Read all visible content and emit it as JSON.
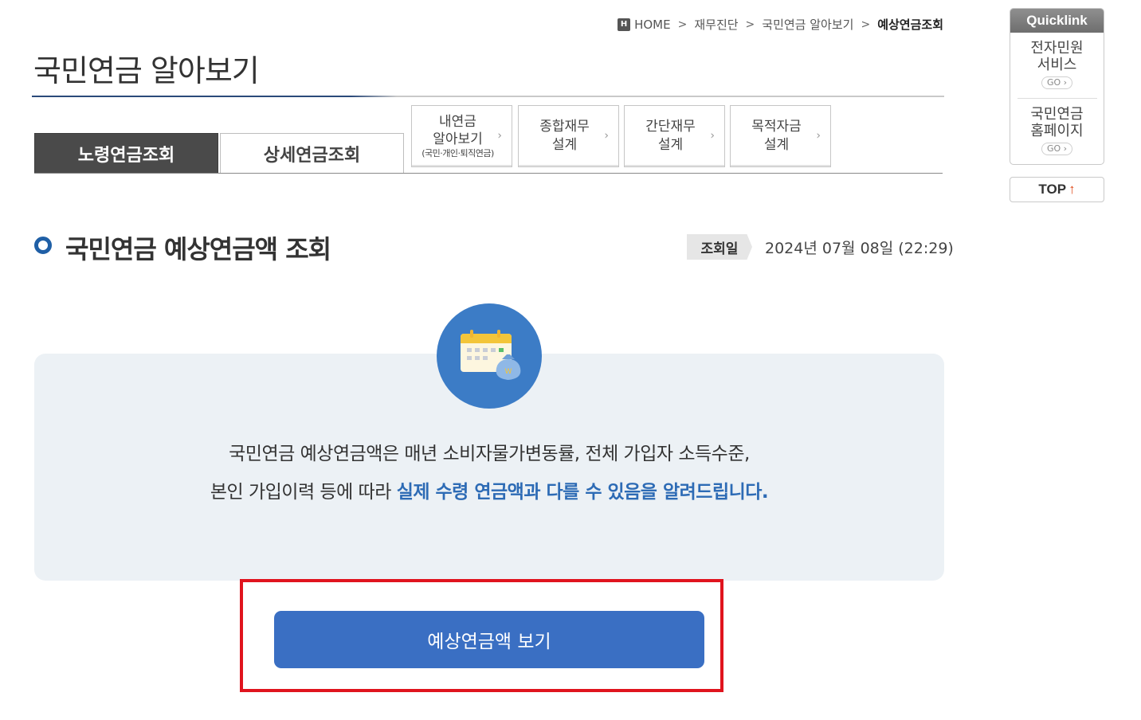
{
  "breadcrumb": {
    "home_badge": "H",
    "items": [
      "HOME",
      "재무진단",
      "국민연금 알아보기",
      "예상연금조회"
    ],
    "separator": ">"
  },
  "page_title": "국민연금 알아보기",
  "tabs": {
    "active": "노령연금조회",
    "inactive": "상세연금조회"
  },
  "subtabs": [
    {
      "line1": "내연금",
      "line2": "알아보기",
      "note": "(국민·개인·퇴직연금)"
    },
    {
      "line1": "종합재무",
      "line2": "설계"
    },
    {
      "line1": "간단재무",
      "line2": "설계"
    },
    {
      "line1": "목적자금",
      "line2": "설계"
    }
  ],
  "chevron": "›",
  "section": {
    "title": "국민연금 예상연금액 조회",
    "inquiry_label": "조회일",
    "inquiry_date": "2024년 07월 08일 (22:29)"
  },
  "notice": {
    "line1": "국민연금 예상연금액은 매년 소비자물가변동률, 전체 가입자 소득수준,",
    "line2_plain": "본인 가입이력 등에 따라 ",
    "line2_highlight": "실제 수령 연금액과 다를 수 있음을 알려드립니다.",
    "icon": "calendar-money-icon"
  },
  "primary_button": "예상연금액 보기",
  "quicklink": {
    "title": "Quicklink",
    "items": [
      {
        "line1": "전자민원",
        "line2": "서비스",
        "go": "GO ›"
      },
      {
        "line1": "국민연금",
        "line2": "홈페이지",
        "go": "GO ›"
      }
    ]
  },
  "top_button": {
    "label": "TOP",
    "arrow": "↑"
  },
  "colors": {
    "accent_blue": "#3a6fc3",
    "highlight_text": "#2d6bb5",
    "active_tab": "#4a4a4a",
    "focus_frame": "#e0141e",
    "info_bg": "#ecf1f5"
  }
}
